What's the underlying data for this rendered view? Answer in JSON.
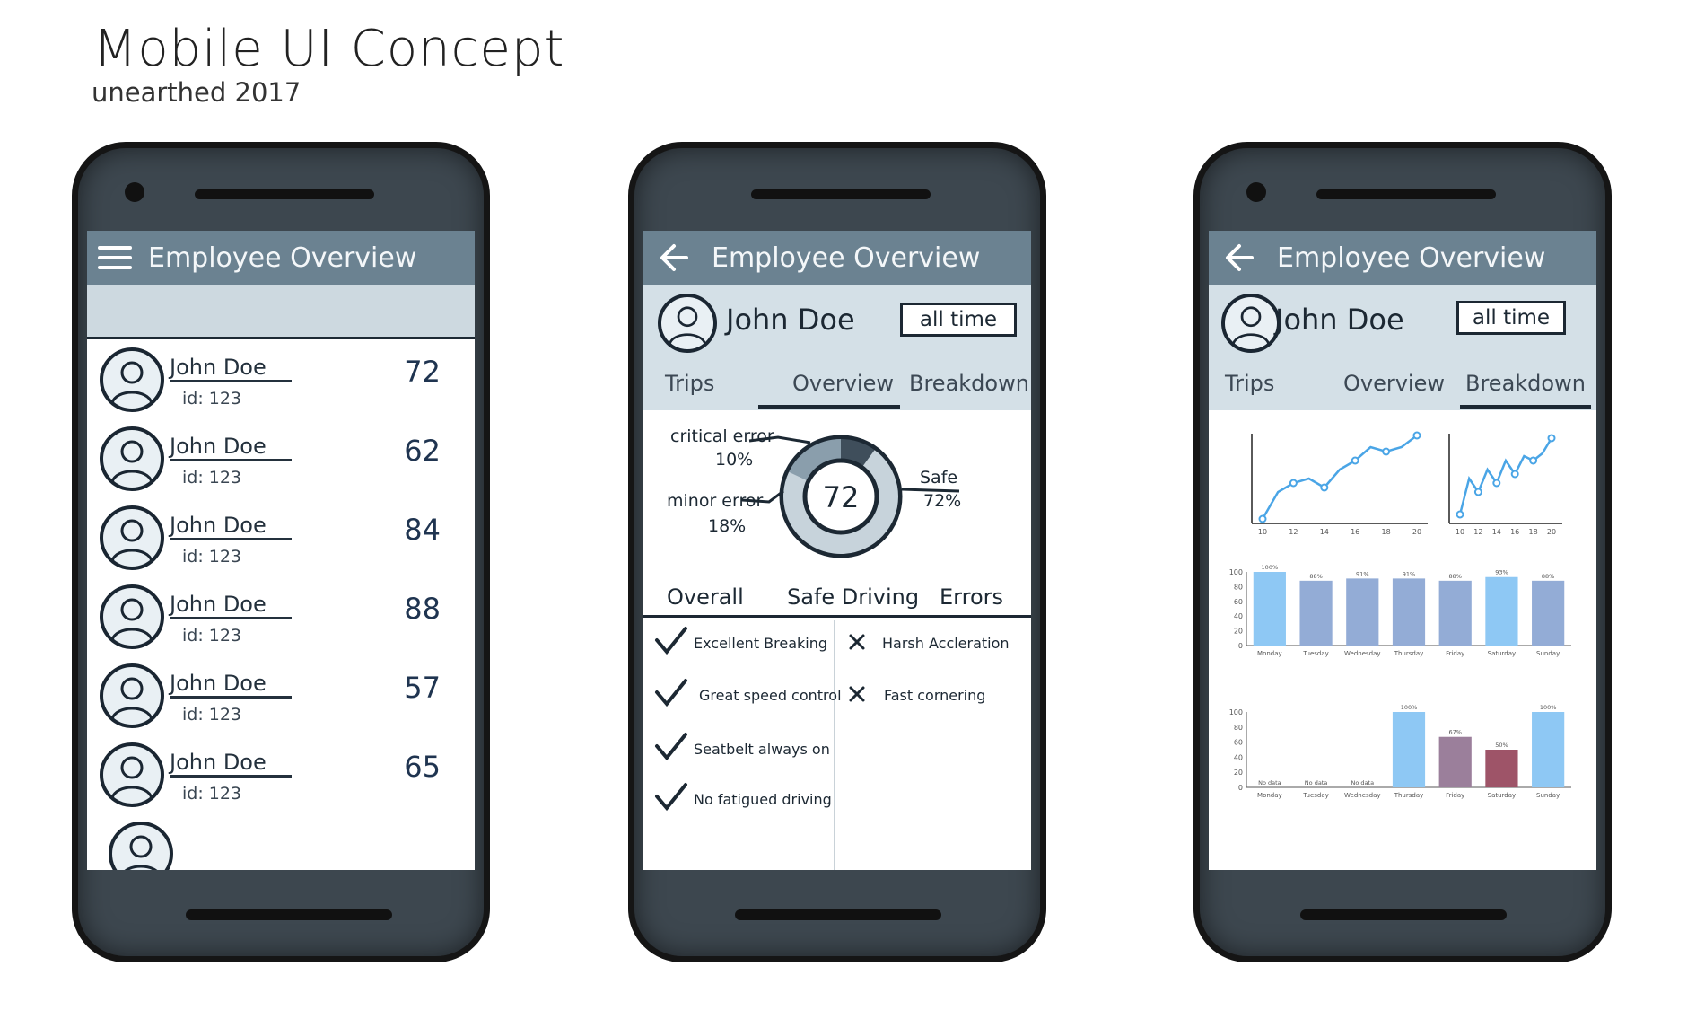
{
  "page": {
    "title": "Mobile UI Concept",
    "subtitle": "unearthed 2017"
  },
  "colors": {
    "appbar": "#6b8291",
    "band": "#cdd9e0",
    "phone_body": "#3d474f",
    "bar_blue": "#8ec8f4",
    "bar_steel": "#93acd6",
    "bar_purple": "#9b7f9b",
    "bar_rose": "#9e5468",
    "line": "#4aa5e6"
  },
  "screen1": {
    "app_title": "Employee Overview",
    "menu_icon": "hamburger-menu-icon",
    "employees": [
      {
        "name": "John Doe",
        "id": "id: 123",
        "score": "72"
      },
      {
        "name": "John Doe",
        "id": "id: 123",
        "score": "62"
      },
      {
        "name": "John Doe",
        "id": "id: 123",
        "score": "84"
      },
      {
        "name": "John Doe",
        "id": "id: 123",
        "score": "88"
      },
      {
        "name": "John Doe",
        "id": "id: 123",
        "score": "57"
      },
      {
        "name": "John Doe",
        "id": "id: 123",
        "score": "65"
      }
    ]
  },
  "screen2": {
    "app_title": "Employee Overview",
    "back_icon": "arrow-left-icon",
    "employee_name": "John Doe",
    "period": "all time",
    "tabs": [
      "Trips",
      "Overview",
      "Breakdown"
    ],
    "active_tab": "Overview",
    "score": "72",
    "breakdown": [
      {
        "label": "critical error",
        "pct": "10%",
        "value": 10
      },
      {
        "label": "minor error",
        "pct": "18%",
        "value": 18
      },
      {
        "label": "Safe",
        "pct": "72%",
        "value": 72
      }
    ],
    "subtabs": [
      "Overall",
      "Safe Driving",
      "Errors"
    ],
    "positives": [
      "Excellent Breaking",
      "Great speed control",
      "Seatbelt always on",
      "No fatigued driving"
    ],
    "negatives": [
      "Harsh Accleration",
      "Fast cornering"
    ]
  },
  "screen3": {
    "app_title": "Employee Overview",
    "back_icon": "arrow-left-icon",
    "employee_name": "John Doe",
    "period": "all time",
    "tabs": [
      "Trips",
      "Overview",
      "Breakdown"
    ],
    "active_tab": "Breakdown"
  },
  "chart_data": [
    {
      "type": "line",
      "x": [
        10,
        11,
        12,
        13,
        14,
        15,
        16,
        17,
        18,
        19,
        20
      ],
      "series": [
        {
          "values": [
            5,
            35,
            45,
            50,
            40,
            60,
            70,
            85,
            80,
            85,
            98
          ]
        }
      ],
      "x_ticks": [
        "10",
        "12",
        "14",
        "16",
        "18",
        "20"
      ],
      "ylim": [
        0,
        100
      ],
      "grid": false
    },
    {
      "type": "line",
      "x": [
        10,
        11,
        12,
        13,
        14,
        15,
        16,
        17,
        18,
        19,
        20
      ],
      "series": [
        {
          "values": [
            10,
            50,
            35,
            60,
            45,
            70,
            55,
            75,
            70,
            78,
            95
          ]
        }
      ],
      "x_ticks": [
        "10",
        "12",
        "14",
        "16",
        "18",
        "20"
      ],
      "ylim": [
        0,
        100
      ],
      "grid": false
    },
    {
      "type": "bar",
      "categories": [
        "Monday",
        "Tuesday",
        "Wednesday",
        "Thursday",
        "Friday",
        "Saturday",
        "Sunday"
      ],
      "values": [
        100,
        88,
        91,
        91,
        88,
        93,
        88
      ],
      "labels": [
        "100%",
        "88%",
        "91%",
        "91%",
        "88%",
        "93%",
        "88%"
      ],
      "y_ticks": [
        "0",
        "20",
        "40",
        "60",
        "80",
        "100"
      ],
      "ylim": [
        0,
        100
      ],
      "grid": false
    },
    {
      "type": "bar",
      "categories": [
        "Monday",
        "Tuesday",
        "Wednesday",
        "Thursday",
        "Friday",
        "Saturday",
        "Sunday"
      ],
      "values": [
        0,
        0,
        0,
        100,
        67,
        50,
        100
      ],
      "labels": [
        "No data",
        "No data",
        "No data",
        "100%",
        "67%",
        "50%",
        "100%"
      ],
      "y_ticks": [
        "0",
        "20",
        "40",
        "60",
        "80",
        "100"
      ],
      "ylim": [
        0,
        100
      ],
      "grid": false
    }
  ]
}
